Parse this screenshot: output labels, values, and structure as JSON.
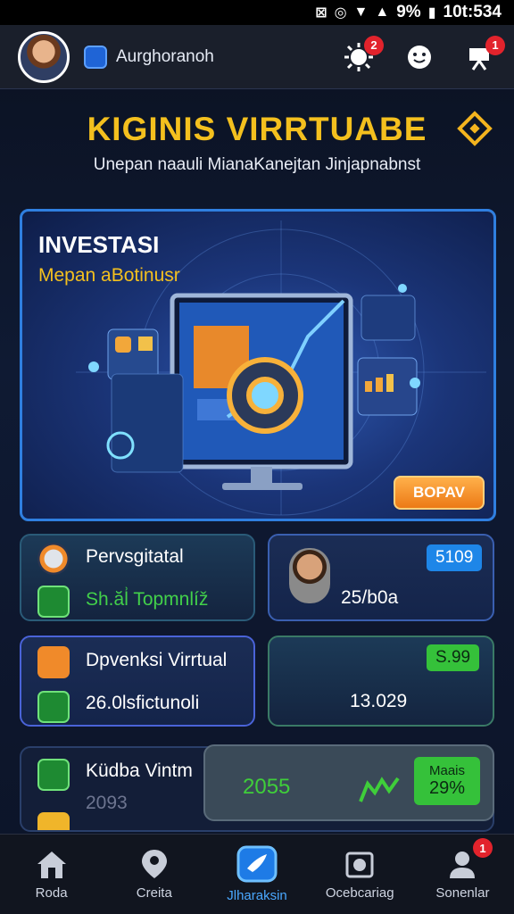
{
  "status_bar": {
    "battery_pct": "9%",
    "time": "10t:534"
  },
  "app_bar": {
    "account_name": "Aurghoranoh",
    "notification_count": "2",
    "profile_badge_count": "1"
  },
  "headline": "KIGINIS VIRRTUABE",
  "subheadline": "Unepan naauli MianaKanejtan Jinjapnabnst",
  "hero": {
    "title": "INVESTASI",
    "subtitle": "Mepan aBotinusr",
    "button_label": "BOPAV"
  },
  "cards": [
    {
      "title": "Pervsgitatal",
      "line2": "Sh.ăl͗ Topmnlíž",
      "value": "25/b0a",
      "pill": "5109"
    },
    {
      "title": "Dpvenksi Virrtual",
      "line2": "26.0lsfictunoli",
      "value": "13.029",
      "pill": "S.99"
    },
    {
      "title": "Küdba Vintm",
      "line2": "2093",
      "line3": "…",
      "value": "2055",
      "pill_title": "Maais",
      "pill": "29%"
    }
  ],
  "bottom_nav": [
    {
      "label": "Roda",
      "icon": "home-icon"
    },
    {
      "label": "Creita",
      "icon": "map-pin-icon"
    },
    {
      "label": "Jlharaksin",
      "icon": "bird-icon",
      "active": true
    },
    {
      "label": "Ocebcariag",
      "icon": "camera-icon"
    },
    {
      "label": "Sonenlar",
      "icon": "user-icon",
      "badge": "1"
    }
  ],
  "colors": {
    "accent_gold": "#f4c01e",
    "accent_blue": "#2f7fe0",
    "accent_orange": "#f08a2a",
    "accent_green": "#3fce3a"
  }
}
